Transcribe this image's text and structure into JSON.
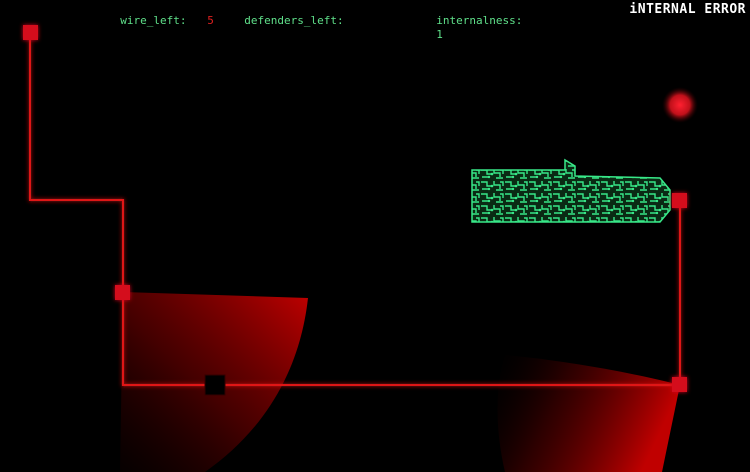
{
  "game_title": "iNTERNAL ERROR",
  "hud": {
    "wire_left_label": "wire_left:",
    "wire_left_value": "5",
    "defenders_left_label": "defenders_left:",
    "defenders_left_value": "",
    "internalness_label": "internalness:",
    "internalness_value": "1"
  },
  "colors": {
    "hud_text": "#5fe08a",
    "hud_value": "#e02020",
    "wire": "#e01818",
    "node": "#d4101c",
    "beam": "#b00000",
    "target": "#30e080",
    "background": "#000000"
  },
  "icons": {
    "wire_node": "red-square",
    "defender": "black-square",
    "target": "green-circuit-board",
    "orb": "red-glow-orb"
  }
}
